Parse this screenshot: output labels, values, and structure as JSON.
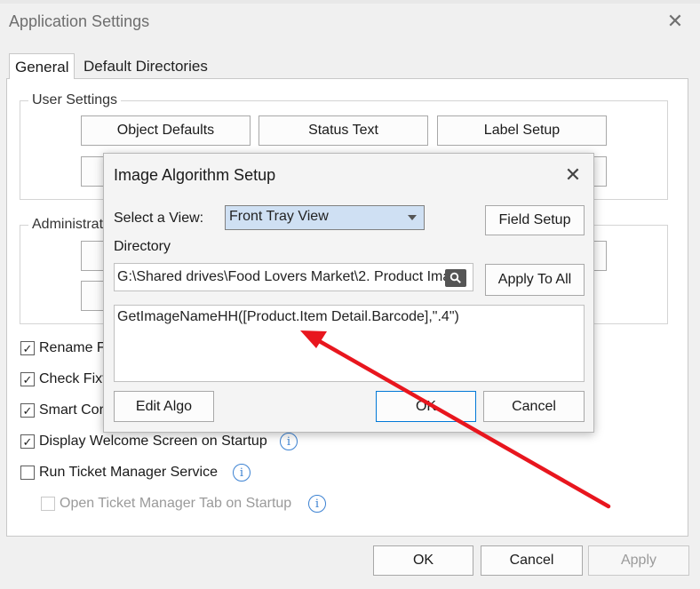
{
  "window": {
    "title": "Application Settings",
    "close_icon": "close-icon"
  },
  "tabs": [
    {
      "label": "General",
      "active": true
    },
    {
      "label": "Default Directories",
      "active": false
    }
  ],
  "user_settings": {
    "label": "User Settings",
    "buttons": [
      "Object Defaults",
      "Status Text",
      "Label Setup"
    ]
  },
  "administration": {
    "label": "Administrat"
  },
  "checkboxes": [
    {
      "label": "Rename F",
      "checked": true
    },
    {
      "label": "Check Fixt",
      "checked": true
    },
    {
      "label": "Smart Cor",
      "checked": true
    },
    {
      "label": "Display Welcome Screen on Startup",
      "checked": true,
      "info_icon": "info-icon"
    },
    {
      "label": "Run Ticket Manager Service",
      "checked": false,
      "info_icon": "info-icon"
    },
    {
      "label": "Open Ticket Manager Tab on Startup",
      "checked": false,
      "disabled": true,
      "info_icon": "info-icon"
    }
  ],
  "footer": {
    "ok": "OK",
    "cancel": "Cancel",
    "apply": "Apply"
  },
  "modal": {
    "title": "Image Algorithm Setup",
    "select_view_label": "Select a View:",
    "select_view_value": "Front Tray View",
    "field_setup": "Field Setup",
    "directory_label": "Directory",
    "directory_value": "G:\\Shared drives\\Food Lovers Market\\2. Product Ima",
    "apply_to_all": "Apply To All",
    "algorithm": "GetImageNameHH([Product.Item Detail.Barcode],\".4\")",
    "edit_algo": "Edit Algo",
    "ok": "OK",
    "cancel": "Cancel"
  },
  "annotation": {
    "color": "#e8161e"
  }
}
